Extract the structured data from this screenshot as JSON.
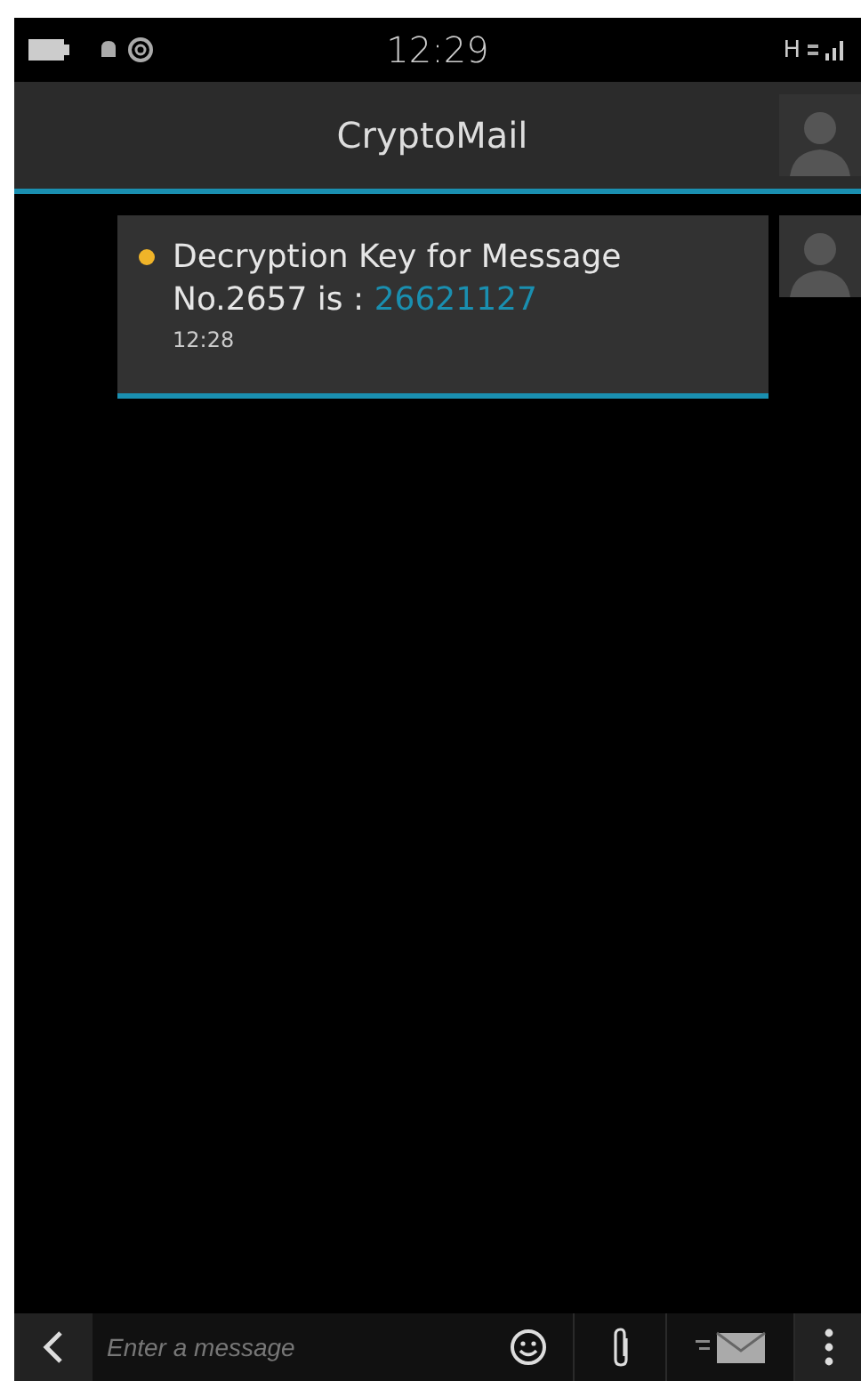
{
  "status_bar": {
    "time": "12:29",
    "network": "H"
  },
  "header": {
    "title": "CryptoMail"
  },
  "messages": [
    {
      "text": "Decryption Key for Message No.2657 is : ",
      "key": "26621127",
      "time": "12:28",
      "unread": true
    }
  ],
  "composer": {
    "placeholder": "Enter a message"
  }
}
